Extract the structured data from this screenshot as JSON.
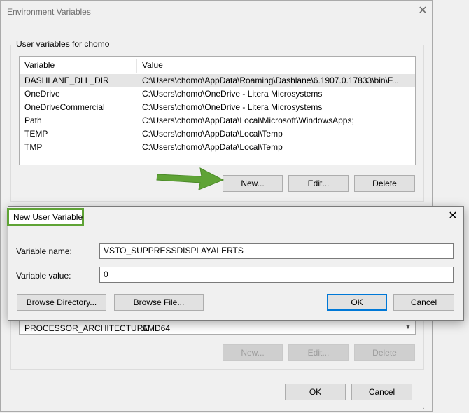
{
  "env_dialog": {
    "title": "Environment Variables",
    "close_glyph": "✕",
    "user_group_label": "User variables for chomo",
    "columns": {
      "variable": "Variable",
      "value": "Value"
    },
    "user_rows": [
      {
        "variable": "DASHLANE_DLL_DIR",
        "value": "C:\\Users\\chomo\\AppData\\Roaming\\Dashlane\\6.1907.0.17833\\bin\\F..."
      },
      {
        "variable": "OneDrive",
        "value": "C:\\Users\\chomo\\OneDrive - Litera Microsystems"
      },
      {
        "variable": "OneDriveCommercial",
        "value": "C:\\Users\\chomo\\OneDrive - Litera Microsystems"
      },
      {
        "variable": "Path",
        "value": "C:\\Users\\chomo\\AppData\\Local\\Microsoft\\WindowsApps;"
      },
      {
        "variable": "TEMP",
        "value": "C:\\Users\\chomo\\AppData\\Local\\Temp"
      },
      {
        "variable": "TMP",
        "value": "C:\\Users\\chomo\\AppData\\Local\\Temp"
      }
    ],
    "user_buttons": {
      "new": "New...",
      "edit": "Edit...",
      "delete": "Delete"
    },
    "system_rows": [
      {
        "variable": "PROCESSOR_ARCHITECTURE",
        "value": "AMD64"
      }
    ],
    "system_buttons": {
      "new": "New...",
      "edit": "Edit...",
      "delete": "Delete"
    },
    "footer_buttons": {
      "ok": "OK",
      "cancel": "Cancel"
    }
  },
  "new_var_dialog": {
    "title": "New User Variable",
    "close_glyph": "✕",
    "name_label": "Variable name:",
    "name_value": "VSTO_SUPPRESSDISPLAYALERTS",
    "value_label": "Variable value:",
    "value_value": "0",
    "browse_directory": "Browse Directory...",
    "browse_file": "Browse File...",
    "ok": "OK",
    "cancel": "Cancel"
  },
  "colors": {
    "highlight": "#5fa336",
    "focus": "#0078d7"
  }
}
